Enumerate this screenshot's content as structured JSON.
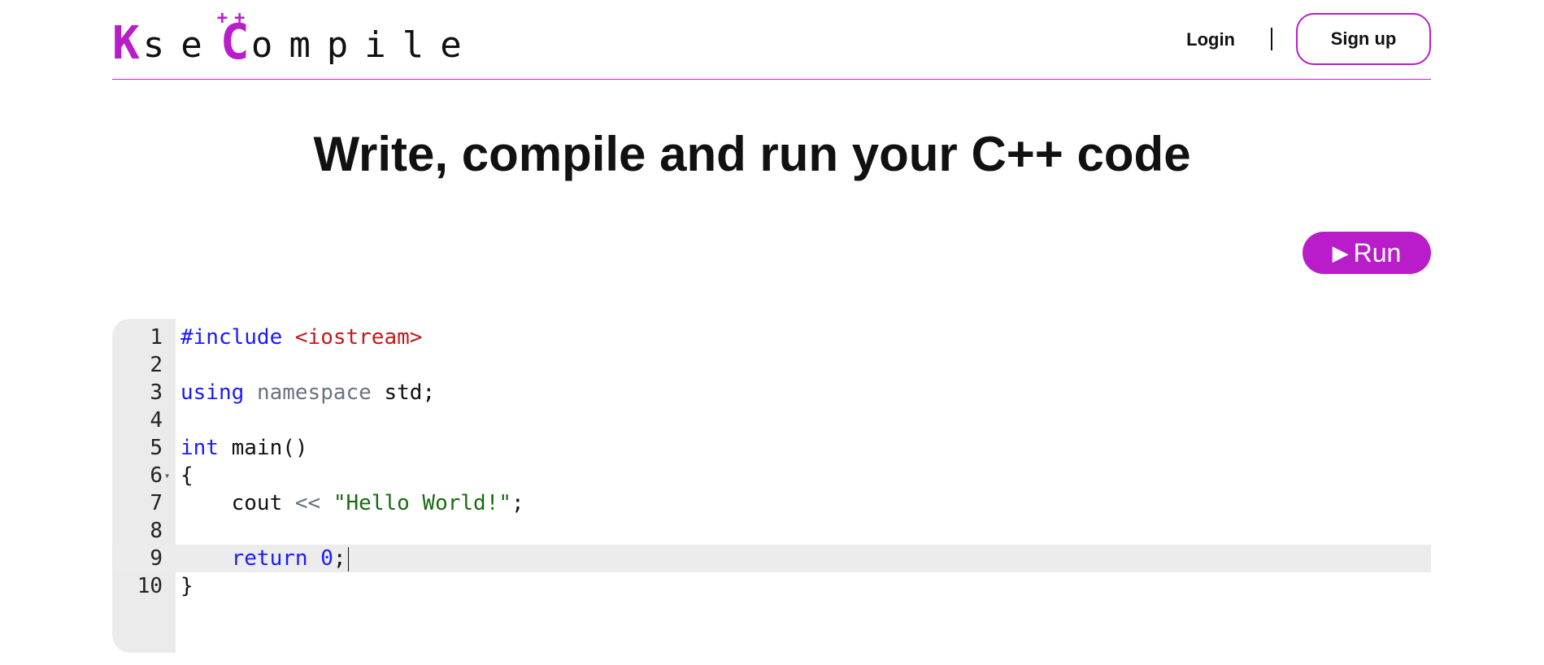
{
  "header": {
    "logo": {
      "k": "K",
      "s_e": "se",
      "plus": "++",
      "c": "C",
      "rest": "ompile"
    },
    "login_label": "Login",
    "signup_label": "Sign up"
  },
  "main": {
    "title": "Write, compile and run your C++ code",
    "run_label": "Run",
    "run_icon": "play-icon"
  },
  "editor": {
    "language": "C++",
    "active_line": 9,
    "lines": [
      {
        "n": "1",
        "tokens": [
          {
            "t": "#include ",
            "c": "kw"
          },
          {
            "t": "<iostream>",
            "c": "inc"
          }
        ]
      },
      {
        "n": "2",
        "tokens": []
      },
      {
        "n": "3",
        "tokens": [
          {
            "t": "using",
            "c": "kw"
          },
          {
            "t": " "
          },
          {
            "t": "namespace",
            "c": "ns"
          },
          {
            "t": " std;"
          }
        ]
      },
      {
        "n": "4",
        "tokens": []
      },
      {
        "n": "5",
        "tokens": [
          {
            "t": "int",
            "c": "kw"
          },
          {
            "t": " main()"
          }
        ]
      },
      {
        "n": "6",
        "tokens": [
          {
            "t": "{"
          }
        ],
        "fold": true
      },
      {
        "n": "7",
        "tokens": [
          {
            "t": "    cout "
          },
          {
            "t": "<<",
            "c": "op"
          },
          {
            "t": " "
          },
          {
            "t": "\"Hello World!\"",
            "c": "str"
          },
          {
            "t": ";"
          }
        ]
      },
      {
        "n": "8",
        "tokens": []
      },
      {
        "n": "9",
        "tokens": [
          {
            "t": "    "
          },
          {
            "t": "return",
            "c": "kw"
          },
          {
            "t": " "
          },
          {
            "t": "0",
            "c": "num"
          },
          {
            "t": ";"
          }
        ],
        "cursor": true
      },
      {
        "n": "10",
        "tokens": [
          {
            "t": "}"
          }
        ]
      }
    ]
  },
  "colors": {
    "accent": "#b91dc9",
    "keyword": "#1a1aff",
    "include": "#c21a1a",
    "string": "#1a6b12"
  }
}
